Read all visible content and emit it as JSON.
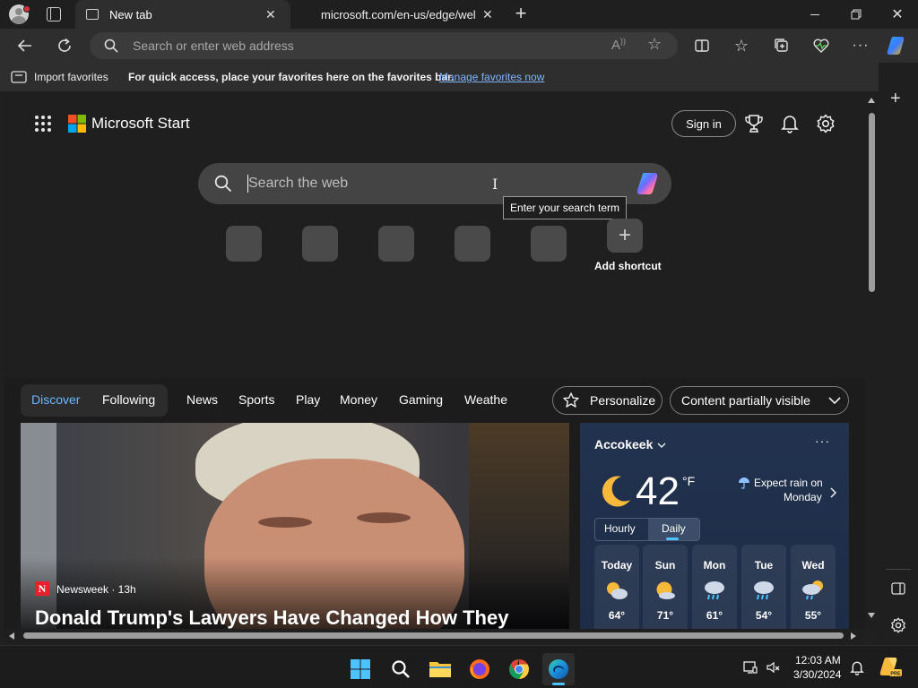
{
  "browser": {
    "tabs": [
      {
        "title": "New tab",
        "active": true
      },
      {
        "title": "microsoft.com/en-us/edge/welc",
        "active": false
      }
    ],
    "address_placeholder": "Search or enter web address",
    "favorites_bar": {
      "import_label": "Import favorites",
      "hint": "For quick access, place your favorites here on the favorites bar.",
      "manage_link": "Manage favorites now"
    }
  },
  "newtab": {
    "brand": "Microsoft Start",
    "sign_in": "Sign in",
    "search_placeholder": "Search the web",
    "tooltip": "Enter your search term",
    "add_shortcut": "Add shortcut"
  },
  "feed": {
    "tabs": [
      {
        "label": "Discover",
        "selected": true
      },
      {
        "label": "Following",
        "selected": false
      }
    ],
    "categories": [
      "News",
      "Sports",
      "Play",
      "Money",
      "Gaming",
      "Weathe"
    ],
    "personalize": "Personalize",
    "visibility": "Content partially visible",
    "article": {
      "source_logo": "N",
      "source": "Newsweek · 13h",
      "headline": "Donald Trump's Lawyers Have Changed How They"
    }
  },
  "weather": {
    "location": "Accokeek",
    "temp": "42",
    "unit": "°F",
    "alert_line1": "Expect rain on",
    "alert_line2": "Monday",
    "modes": [
      {
        "label": "Hourly",
        "selected": false
      },
      {
        "label": "Daily",
        "selected": true
      }
    ],
    "days": [
      {
        "name": "Today",
        "temp": "64°",
        "icon": "partly-sunny-icon"
      },
      {
        "name": "Sun",
        "temp": "71°",
        "icon": "mostly-sunny-icon"
      },
      {
        "name": "Mon",
        "temp": "61°",
        "icon": "rain-icon"
      },
      {
        "name": "Tue",
        "temp": "54°",
        "icon": "rain-icon"
      },
      {
        "name": "Wed",
        "temp": "55°",
        "icon": "rain-showers-icon"
      }
    ]
  },
  "taskbar": {
    "time": "12:03 AM",
    "date": "3/30/2024"
  },
  "colors": {
    "accent": "#4cc2ff",
    "link": "#7fb3ff",
    "ms_red": "#f25022",
    "ms_green": "#7fba00",
    "ms_blue": "#00a4ef",
    "ms_yellow": "#ffb900"
  }
}
